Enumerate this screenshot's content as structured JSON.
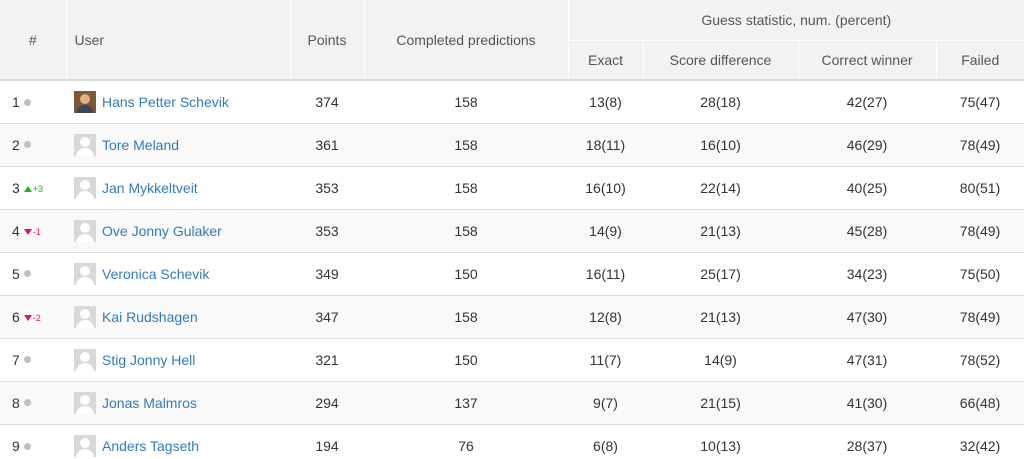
{
  "headers": {
    "rank": "#",
    "user": "User",
    "points": "Points",
    "completed": "Completed predictions",
    "guess_stat": "Guess statistic, num. (percent)",
    "exact": "Exact",
    "score_diff": "Score difference",
    "correct_winner": "Correct winner",
    "failed": "Failed"
  },
  "colors": {
    "link": "#337ab7",
    "trend_up": "#1fb51f",
    "trend_down": "#e0194a",
    "no_change": "#c0c0c0"
  },
  "rows": [
    {
      "rank": "1",
      "trend": "none",
      "trend_value": "",
      "avatar": "photo",
      "name": "Hans Petter Schevik",
      "points": "374",
      "completed": "158",
      "exact": "13(8)",
      "score_diff": "28(18)",
      "correct_winner": "42(27)",
      "failed": "75(47)"
    },
    {
      "rank": "2",
      "trend": "none",
      "trend_value": "",
      "avatar": "placeholder",
      "name": "Tore Meland",
      "points": "361",
      "completed": "158",
      "exact": "18(11)",
      "score_diff": "16(10)",
      "correct_winner": "46(29)",
      "failed": "78(49)"
    },
    {
      "rank": "3",
      "trend": "up",
      "trend_value": "+3",
      "avatar": "placeholder",
      "name": "Jan Mykkeltveit",
      "points": "353",
      "completed": "158",
      "exact": "16(10)",
      "score_diff": "22(14)",
      "correct_winner": "40(25)",
      "failed": "80(51)"
    },
    {
      "rank": "4",
      "trend": "down",
      "trend_value": "-1",
      "avatar": "placeholder",
      "name": "Ove Jonny Gulaker",
      "points": "353",
      "completed": "158",
      "exact": "14(9)",
      "score_diff": "21(13)",
      "correct_winner": "45(28)",
      "failed": "78(49)"
    },
    {
      "rank": "5",
      "trend": "none",
      "trend_value": "",
      "avatar": "placeholder",
      "name": "Veronica Schevik",
      "points": "349",
      "completed": "150",
      "exact": "16(11)",
      "score_diff": "25(17)",
      "correct_winner": "34(23)",
      "failed": "75(50)"
    },
    {
      "rank": "6",
      "trend": "down",
      "trend_value": "-2",
      "avatar": "placeholder",
      "name": "Kai Rudshagen",
      "points": "347",
      "completed": "158",
      "exact": "12(8)",
      "score_diff": "21(13)",
      "correct_winner": "47(30)",
      "failed": "78(49)"
    },
    {
      "rank": "7",
      "trend": "none",
      "trend_value": "",
      "avatar": "placeholder",
      "name": "Stig Jonny Hell",
      "points": "321",
      "completed": "150",
      "exact": "11(7)",
      "score_diff": "14(9)",
      "correct_winner": "47(31)",
      "failed": "78(52)"
    },
    {
      "rank": "8",
      "trend": "none",
      "trend_value": "",
      "avatar": "placeholder",
      "name": "Jonas Malmros",
      "points": "294",
      "completed": "137",
      "exact": "9(7)",
      "score_diff": "21(15)",
      "correct_winner": "41(30)",
      "failed": "66(48)"
    },
    {
      "rank": "9",
      "trend": "none",
      "trend_value": "",
      "avatar": "placeholder",
      "name": "Anders Tagseth",
      "points": "194",
      "completed": "76",
      "exact": "6(8)",
      "score_diff": "10(13)",
      "correct_winner": "28(37)",
      "failed": "32(42)"
    }
  ]
}
